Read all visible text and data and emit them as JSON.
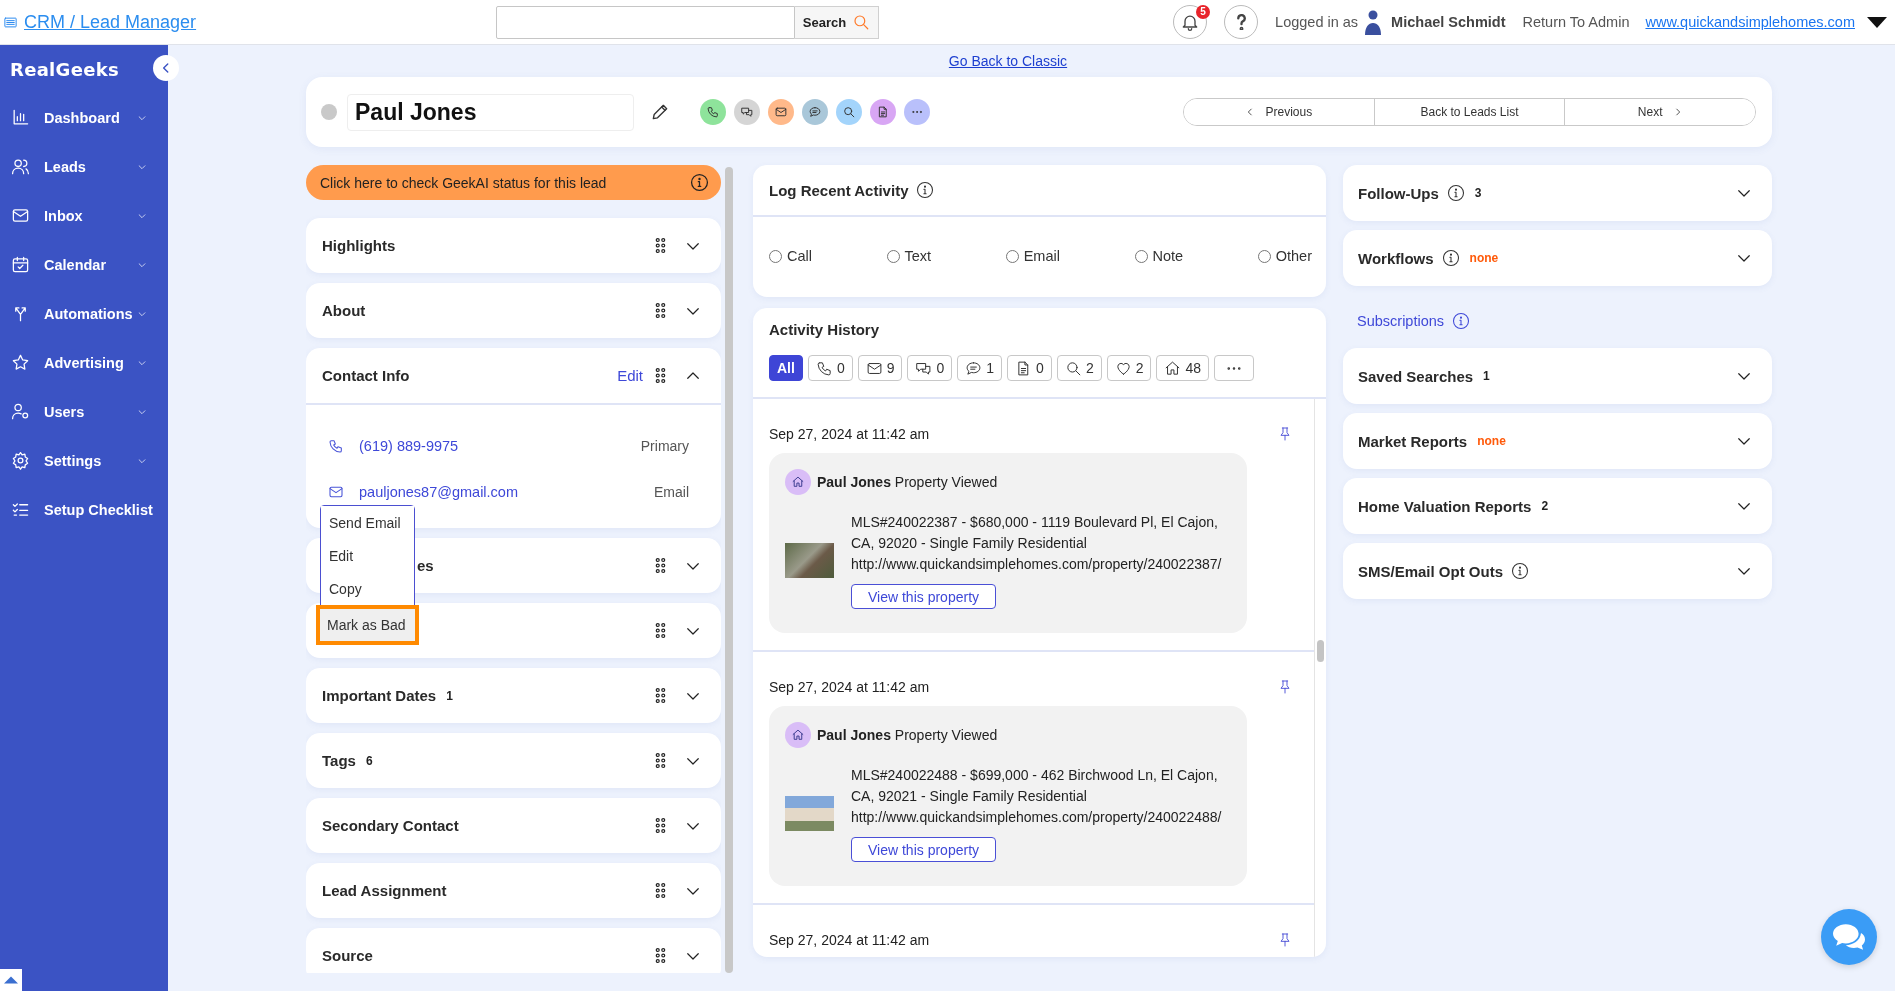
{
  "top_bar": {
    "app_title": "CRM / Lead Manager",
    "search_button": "Search",
    "notification_count": "5",
    "logged_in_label": "Logged in as",
    "user_name": "Michael Schmidt",
    "return_link": "Return To Admin",
    "site_link": "www.quickandsimplehomes.com"
  },
  "sidebar": {
    "logo": "RealGeeks",
    "items": [
      {
        "label": "Dashboard",
        "has_submenu": true,
        "selected": false
      },
      {
        "label": "Leads",
        "has_submenu": true,
        "selected": false
      },
      {
        "label": "Inbox",
        "has_submenu": true,
        "selected": false
      },
      {
        "label": "Calendar",
        "has_submenu": true,
        "selected": false
      },
      {
        "label": "Automations",
        "has_submenu": true,
        "selected": false
      },
      {
        "label": "Advertising",
        "has_submenu": true,
        "selected": false
      },
      {
        "label": "Users",
        "has_submenu": true,
        "selected": false
      },
      {
        "label": "Settings",
        "has_submenu": true,
        "selected": false
      },
      {
        "label": "Setup Checklist",
        "has_submenu": false,
        "selected": false
      }
    ]
  },
  "classic_link": "Go Back to Classic",
  "lead_header": {
    "name": "Paul Jones",
    "actions": [
      {
        "color": "#8ee39b"
      },
      {
        "color": "#d5d5d5"
      },
      {
        "color": "#ffb98a"
      },
      {
        "color": "#a9c7d9"
      },
      {
        "color": "#a3d4fb"
      },
      {
        "color": "#d8a6f4"
      },
      {
        "color": "#b9c0fb"
      }
    ],
    "navigation": [
      "Previous",
      "Back to Leads List",
      "Next"
    ]
  },
  "geekai_banner": "Click here to check GeekAI status for this lead",
  "left_cards": [
    {
      "title": "Highlights",
      "expanded": false,
      "under_menu": false
    },
    {
      "title": "About",
      "expanded": false,
      "under_menu": false
    },
    {
      "title": "Contact Info",
      "edit_link": "Edit",
      "expanded": true,
      "under_menu": false,
      "contacts": [
        {
          "kind": "phone",
          "value": "(619) 889-9975",
          "label": "Primary"
        },
        {
          "kind": "email",
          "value": "pauljones87@gmail.com",
          "label": "Email"
        }
      ]
    },
    {
      "title": "es",
      "expanded": false,
      "under_menu": true
    },
    {
      "expanded": false,
      "under_menu": true
    },
    {
      "title": "Important Dates",
      "count": "1",
      "expanded": false,
      "under_menu": false
    },
    {
      "title": "Tags",
      "count": "6",
      "expanded": false,
      "under_menu": false
    },
    {
      "title": "Secondary Contact",
      "expanded": false,
      "under_menu": false
    },
    {
      "title": "Lead Assignment",
      "expanded": false,
      "under_menu": false
    },
    {
      "title": "Source",
      "expanded": false,
      "under_menu": false
    }
  ],
  "context_menu": [
    {
      "label": "Send Email",
      "highlighted": false
    },
    {
      "label": "Edit",
      "highlighted": false
    },
    {
      "label": "Copy",
      "highlighted": false
    },
    {
      "label": "Mark as Bad",
      "highlighted": true
    }
  ],
  "log_activity": {
    "title": "Log Recent Activity",
    "options": [
      {
        "label": "Call",
        "selected": false
      },
      {
        "label": "Text",
        "selected": false
      },
      {
        "label": "Email",
        "selected": false
      },
      {
        "label": "Note",
        "selected": false
      },
      {
        "label": "Other",
        "selected": false
      }
    ]
  },
  "activity_history": {
    "title": "Activity History",
    "filters": [
      {
        "label": "All",
        "selected": true
      },
      {
        "count": "0",
        "selected": false
      },
      {
        "count": "9",
        "selected": false
      },
      {
        "count": "0",
        "selected": false
      },
      {
        "count": "1",
        "selected": false
      },
      {
        "count": "0",
        "selected": false
      },
      {
        "count": "2",
        "selected": false
      },
      {
        "count": "2",
        "selected": false
      },
      {
        "count": "48",
        "selected": false
      },
      {
        "selected": false
      }
    ],
    "entries": [
      {
        "date": "Sep 27, 2024 at 11:42 am",
        "summary": "**Paul Jones** Property Viewed",
        "details": "MLS#240022387 - $680,000 - 1119 Boulevard Pl, El Cajon, CA, 92020 - Single Family Residential",
        "url": "http://www.quickandsimplehomes.com/property/240022387/",
        "button": "View this property"
      },
      {
        "date": "Sep 27, 2024 at 11:42 am",
        "summary": "**Paul Jones** Property Viewed",
        "details": "MLS#240022488 - $699,000 - 462 Birchwood Ln, El Cajon, CA, 92021 - Single Family Residential",
        "url": "http://www.quickandsimplehomes.com/property/240022488/",
        "button": "View this property"
      },
      {
        "date": "Sep 27, 2024 at 11:42 am"
      }
    ]
  },
  "right_panel": [
    {
      "kind": "section",
      "title": "Follow-Ups",
      "info": true,
      "count": "3",
      "expanded": false
    },
    {
      "kind": "section",
      "title": "Workflows",
      "info": true,
      "status": "none",
      "expanded": false
    },
    {
      "kind": "link",
      "title": "Subscriptions",
      "info": true
    },
    {
      "kind": "section",
      "title": "Saved Searches",
      "info": false,
      "count": "1",
      "expanded": false
    },
    {
      "kind": "section",
      "title": "Market Reports",
      "info": false,
      "status": "none",
      "expanded": false
    },
    {
      "kind": "section",
      "title": "Home Valuation Reports",
      "info": false,
      "count": "2",
      "expanded": false
    },
    {
      "kind": "section",
      "title": "SMS/Email Opt Outs",
      "info": true,
      "expanded": false
    }
  ]
}
